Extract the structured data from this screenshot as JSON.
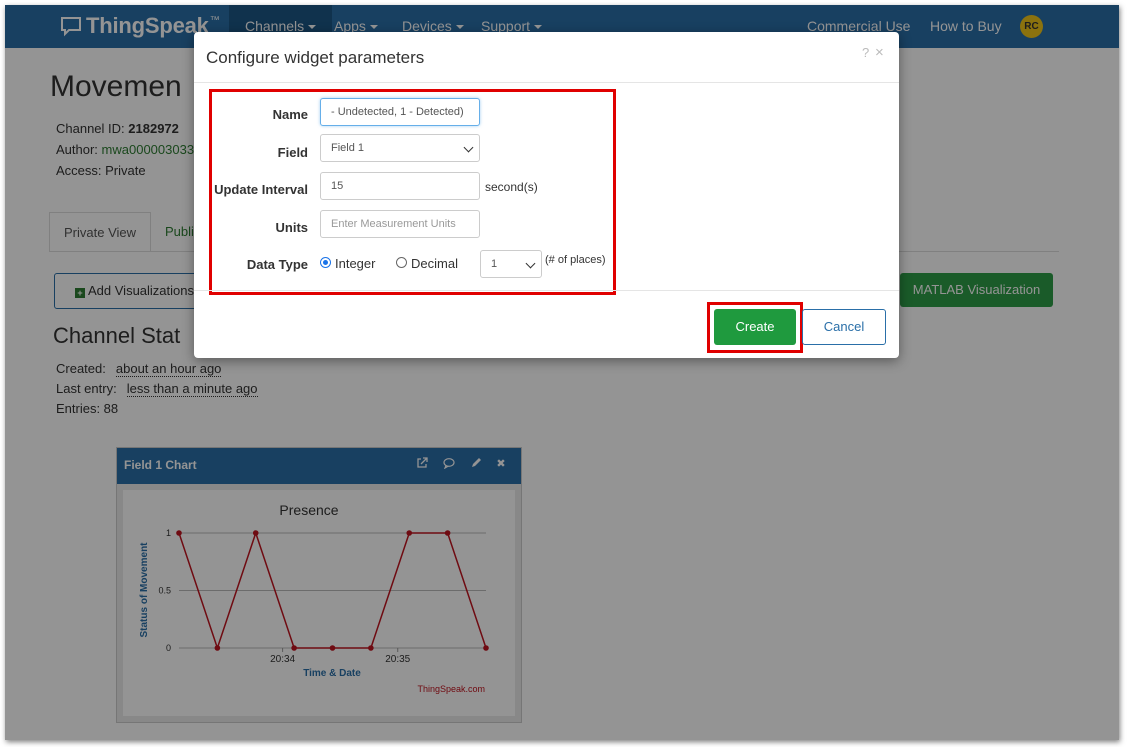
{
  "navbar": {
    "brand": "ThingSpeak",
    "trademark": "™",
    "menu": [
      {
        "label": "Channels"
      },
      {
        "label": "Apps"
      },
      {
        "label": "Devices"
      },
      {
        "label": "Support"
      }
    ],
    "right_links": [
      {
        "label": "Commercial Use"
      },
      {
        "label": "How to Buy"
      }
    ],
    "avatar_initials": "RC"
  },
  "page": {
    "title": "Movemen",
    "channel_id_label": "Channel ID:",
    "channel_id": "2182972",
    "author_label": "Author:",
    "author": "mwa000003033",
    "access": "Access: Private",
    "tabs": [
      {
        "label": "Private View"
      },
      {
        "label": "Publi"
      }
    ],
    "add_visualizations": "Add Visualizations",
    "matlab_visualization": "MATLAB Visualization",
    "status_title": "Channel Stat",
    "created_label": "Created:",
    "created_value": "about an hour ago",
    "last_entry_label": "Last entry:",
    "last_entry_value": "less than a minute ago",
    "entries": "Entries: 88"
  },
  "widget": {
    "title": "Field 1 Chart",
    "icons": [
      "external-link-icon",
      "comment-icon",
      "pencil-icon",
      "close-icon"
    ]
  },
  "chart_data": {
    "type": "line",
    "title": "Presence",
    "xlabel": "Time & Date",
    "ylabel": "Status of Movement",
    "x_tick_labels": [
      "20:34",
      "20:35"
    ],
    "y_ticks": [
      0,
      0.5,
      1
    ],
    "ylim": [
      0,
      1
    ],
    "values": [
      1,
      0,
      1,
      0,
      0,
      0,
      1,
      1,
      0
    ],
    "credit": "ThingSpeak.com",
    "color": "#c0141f"
  },
  "modal": {
    "title": "Configure widget parameters",
    "help": "?",
    "close": "×",
    "name_label": "Name",
    "name_value": "- Undetected, 1 - Detected)",
    "field_label": "Field",
    "field_value": "Field 1",
    "interval_label": "Update Interval",
    "interval_value": "15",
    "interval_unit": "second(s)",
    "units_label": "Units",
    "units_placeholder": "Enter Measurement Units",
    "data_type_label": "Data Type",
    "integer_label": "Integer",
    "decimal_label": "Decimal",
    "places_value": "1",
    "places_hint": "(# of places)",
    "create": "Create",
    "cancel": "Cancel"
  },
  "colors": {
    "navbar": "#2a6fa8",
    "create_button": "#1f9a3e",
    "highlight": "#e00000"
  }
}
